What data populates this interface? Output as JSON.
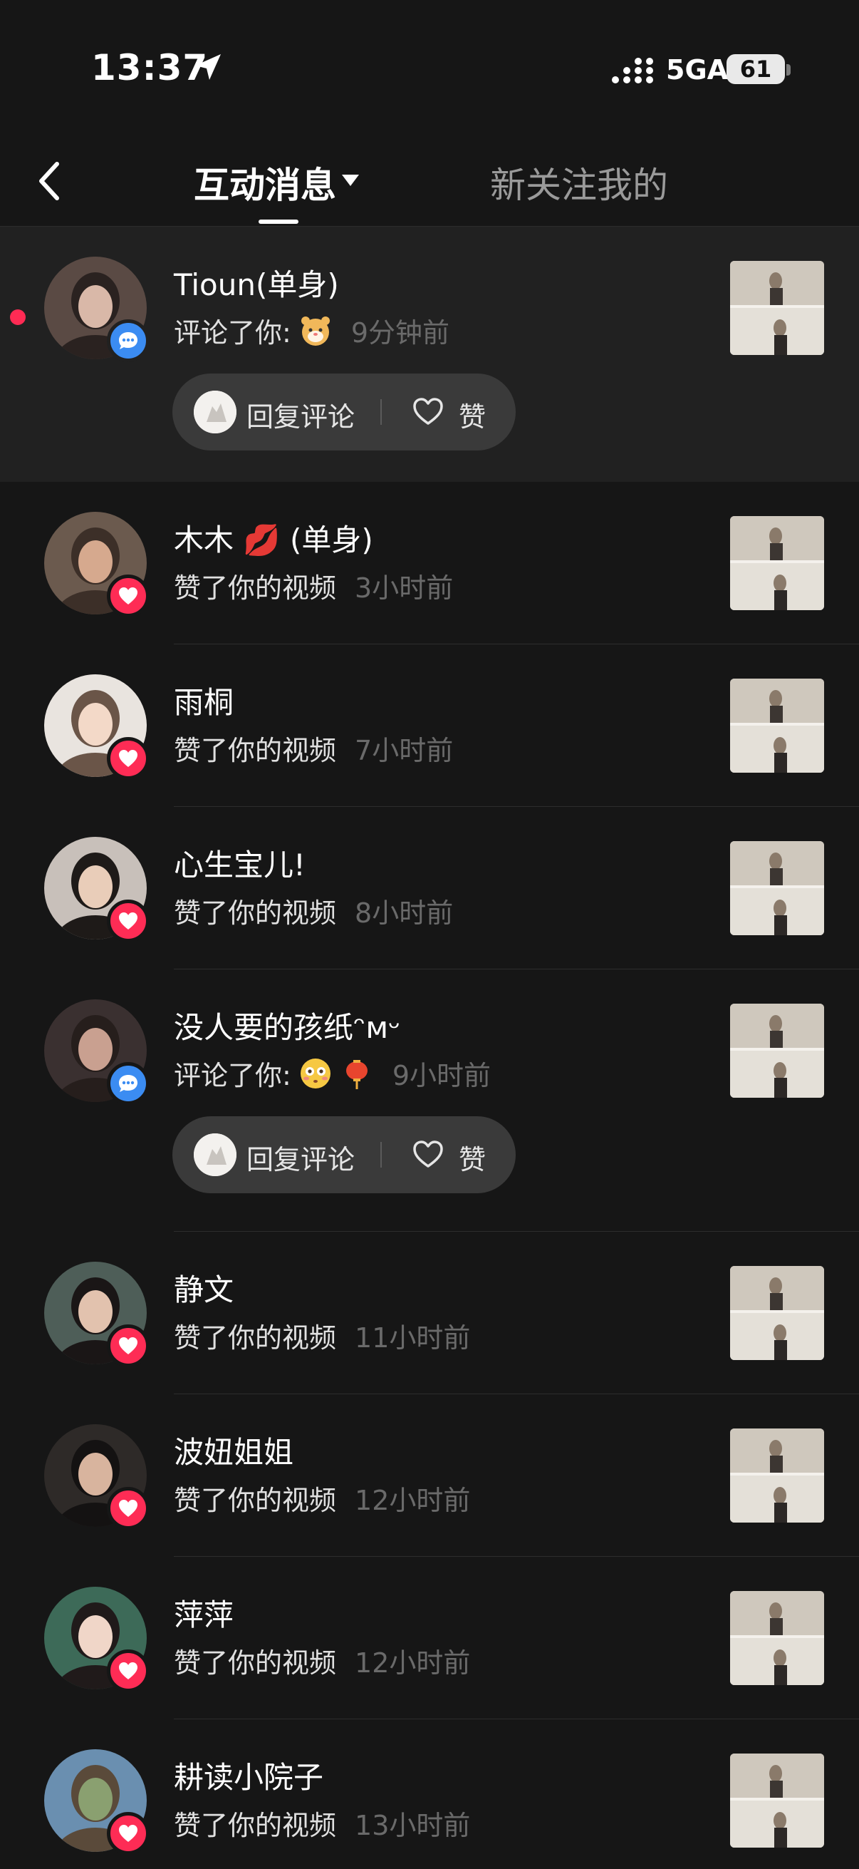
{
  "status_bar": {
    "time": "13:37",
    "network": "5GA",
    "battery": "61"
  },
  "nav": {
    "tab_active": "互动消息",
    "tab_inactive": "新关注我的"
  },
  "colors": {
    "like_badge": "#fe2c55",
    "comment_badge": "#3b8cf2",
    "unread_dot": "#ff2b54"
  },
  "notifications": [
    {
      "name": "Tioun(单身)",
      "action": "评论了你:",
      "time": "9分钟前",
      "type": "comment",
      "unread": true,
      "has_emoji": true,
      "emoji": [
        "tiger-face"
      ],
      "reply_label": "回复评论",
      "like_label": "赞"
    },
    {
      "name": "木木 💋 (单身)",
      "action": "赞了你的视频",
      "time": "3小时前",
      "type": "like"
    },
    {
      "name": "雨桐",
      "action": "赞了你的视频",
      "time": "7小时前",
      "type": "like"
    },
    {
      "name": "心生宝儿!",
      "action": "赞了你的视频",
      "time": "8小时前",
      "type": "like"
    },
    {
      "name": "没人要的孩纸ᵔᴍᵕ",
      "action": "评论了你:",
      "time": "9小时前",
      "type": "comment",
      "has_emoji": true,
      "emoji": [
        "flushed-face",
        "lantern"
      ],
      "reply_label": "回复评论",
      "like_label": "赞"
    },
    {
      "name": "静文",
      "action": "赞了你的视频",
      "time": "11小时前",
      "type": "like"
    },
    {
      "name": "波妞姐姐",
      "action": "赞了你的视频",
      "time": "12小时前",
      "type": "like"
    },
    {
      "name": "萍萍",
      "action": "赞了你的视频",
      "time": "12小时前",
      "type": "like"
    },
    {
      "name": "耕读小院子",
      "action": "赞了你的视频",
      "time": "13小时前",
      "type": "like"
    }
  ]
}
